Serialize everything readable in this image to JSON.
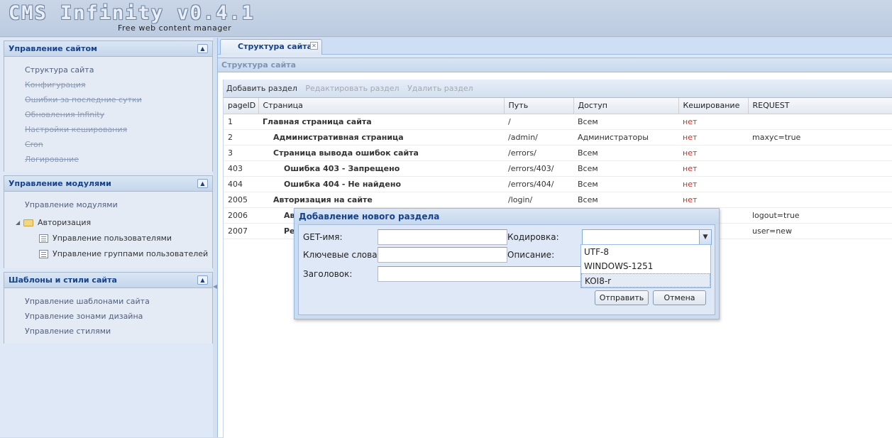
{
  "header": {
    "logo": "CMS Infinity v0.4.1",
    "tagline": "Free web content manager"
  },
  "sidebar": {
    "site_panel": {
      "title": "Управление сайтом",
      "items": [
        {
          "label": "Структура сайта",
          "disabled": false
        },
        {
          "label": "Конфигурация",
          "disabled": true
        },
        {
          "label": "Ошибки за последние сутки",
          "disabled": true
        },
        {
          "label": "Обновления Infinity",
          "disabled": true
        },
        {
          "label": "Настройки кеширования",
          "disabled": true
        },
        {
          "label": "Cron",
          "disabled": true
        },
        {
          "label": "Логирование",
          "disabled": true
        }
      ]
    },
    "modules_panel": {
      "title": "Управление модулями",
      "link": "Управление модулями",
      "folder": "Авторизация",
      "children": [
        "Управление пользователями",
        "Управление группами пользователей"
      ]
    },
    "templates_panel": {
      "title": "Шаблоны и стили сайта",
      "items": [
        "Управление шаблонами сайта",
        "Управление зонами дизайна",
        "Управление стилями"
      ]
    }
  },
  "main": {
    "tab_label": "Структура сайта",
    "panel_title": "Структура сайта",
    "toolbar": {
      "add": "Добавить раздел",
      "edit": "Редактировать раздел",
      "delete": "Удалить раздел"
    },
    "columns": [
      "pageID",
      "Страница",
      "Путь",
      "Доступ",
      "Кеширование",
      "REQUEST"
    ],
    "rows": [
      {
        "id": "1",
        "page": "Главная страница сайта",
        "path": "/",
        "access": "Всем",
        "cache": "нет",
        "request": "",
        "indent": 0
      },
      {
        "id": "2",
        "page": "Административная страница",
        "path": "/admin/",
        "access": "Администраторы",
        "cache": "нет",
        "request": "maxyc=true",
        "indent": 1
      },
      {
        "id": "3",
        "page": "Страница вывода ошибок сайта",
        "path": "/errors/",
        "access": "Всем",
        "cache": "нет",
        "request": "",
        "indent": 1
      },
      {
        "id": "403",
        "page": "Ошибка 403 - Запрещено",
        "path": "/errors/403/",
        "access": "Всем",
        "cache": "нет",
        "request": "",
        "indent": 2
      },
      {
        "id": "404",
        "page": "Ошибка 404 - Не найдено",
        "path": "/errors/404/",
        "access": "Всем",
        "cache": "нет",
        "request": "",
        "indent": 2
      },
      {
        "id": "2005",
        "page": "Авторизация на сайте",
        "path": "/login/",
        "access": "Всем",
        "cache": "нет",
        "request": "",
        "indent": 1
      },
      {
        "id": "2006",
        "page": "Ав",
        "path": "",
        "access": "",
        "cache": "",
        "request": "logout=true",
        "indent": 2
      },
      {
        "id": "2007",
        "page": "Ре",
        "path": "",
        "access": "",
        "cache": "",
        "request": "user=new",
        "indent": 2
      }
    ]
  },
  "dialog": {
    "title": "Добавление нового раздела",
    "get_name_label": "GET-имя:",
    "get_name_value": "",
    "keywords_label": "Ключевые слова:",
    "keywords_value": "",
    "heading_label": "Заголовок:",
    "heading_value": "",
    "encoding_label": "Кодировка:",
    "encoding_value": "",
    "description_label": "Описание:",
    "encoding_options": [
      "UTF-8",
      "WINDOWS-1251",
      "KOI8-r"
    ],
    "highlighted_option": "KOI8-r",
    "submit": "Отправить",
    "cancel": "Отмена"
  }
}
